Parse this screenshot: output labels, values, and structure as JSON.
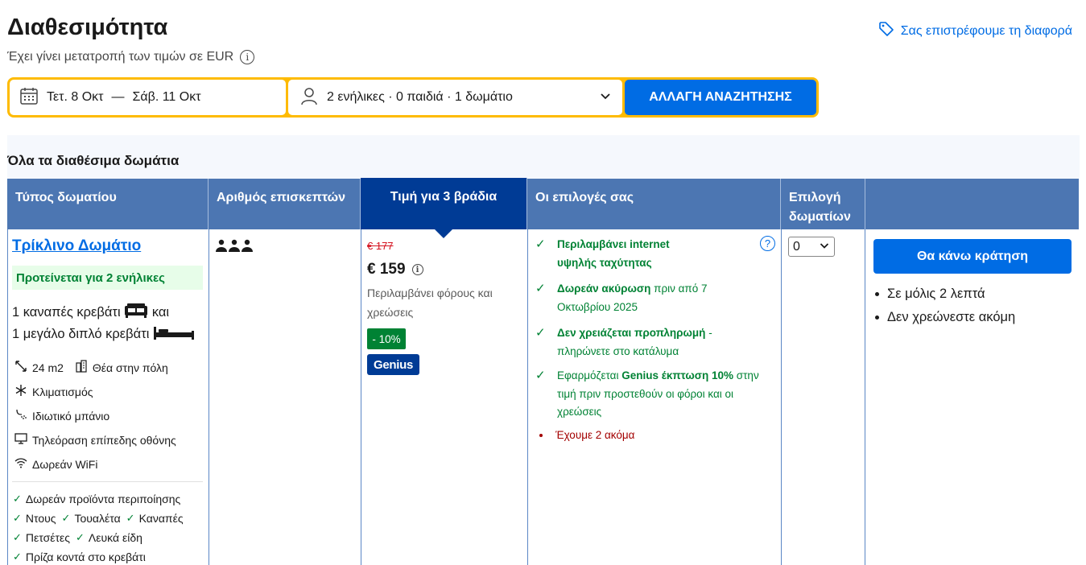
{
  "header": {
    "title": "Διαθεσιμότητα",
    "subtitle": "Έχει γίνει μετατροπή των τιμών σε EUR",
    "info_glyph": "i",
    "price_match": "Σας επιστρέφουμε τη διαφορά"
  },
  "search": {
    "checkin": "Τετ. 8 Οκτ",
    "separator": "—",
    "checkout": "Σάβ. 11 Οκτ",
    "guests": "2 ενήλικες · 0 παιδιά · 1 δωμάτιο",
    "button": "ΑΛΛΑΓΗ ΑΝΑΖΗΤΗΣΗΣ"
  },
  "section_title": "Όλα τα διαθέσιμα δωμάτια",
  "table_headers": {
    "room_type": "Τύπος δωματίου",
    "guests": "Αριθμός επισκεπτών",
    "price": "Τιμή για 3 βράδια",
    "options": "Οι επιλογές σας",
    "select_line1": "Επιλογή",
    "select_line2": "δωματίων"
  },
  "room": {
    "name": "Τρίκλινο Δωμάτιο",
    "recommended": "Προτείνεται για 2 ενήλικες",
    "bed1": "1 καναπές κρεβάτι",
    "bed_and": "και",
    "bed2": "1 μεγάλο διπλό κρεβάτι",
    "size": "24 m2",
    "view": "Θέα στην πόλη",
    "ac": "Κλιματισμός",
    "bathroom": "Ιδιωτικό μπάνιο",
    "tv": "Τηλεόραση επίπεδης οθόνης",
    "wifi": "Δωρεάν WiFi",
    "amenities": {
      "toiletries": "Δωρεάν προϊόντα περιποίησης",
      "shower": "Ντους",
      "toilet": "Τουαλέτα",
      "sofa": "Καναπές",
      "towels": "Πετσέτες",
      "linen": "Λευκά είδη",
      "socket": "Πρίζα κοντά στο κρεβάτι"
    }
  },
  "pricing": {
    "old_price": "€ 177",
    "price": "€ 159",
    "tax_note": "Περιλαμβάνει φόρους και χρεώσεις",
    "discount": "- 10%",
    "genius": "Genius"
  },
  "options": {
    "internet_bold": "Περιλαμβάνει internet υψηλής ταχύτητας",
    "cancel_bold": "Δωρεάν ακύρωση",
    "cancel_rest": "πριν από 7 Οκτωβρίου 2025",
    "prepay_bold": "Δεν χρειάζεται προπληρωμή",
    "prepay_rest": "- πληρώνετε στο κατάλυμα",
    "genius_pre": "Εφαρμόζεται",
    "genius_bold": "Genius έκπτωση 10%",
    "genius_rest": "στην τιμή πριν προστεθούν οι φόροι και οι χρεώσεις",
    "scarcity": "Έχουμε 2 ακόμα",
    "help_glyph": "?"
  },
  "select": {
    "value": "0"
  },
  "reserve": {
    "button": "Θα κάνω κράτηση",
    "bullet1": "Σε μόλις 2 λεπτά",
    "bullet2": "Δεν χρεώνεστε ακόμη"
  },
  "colors": {
    "brand_blue": "#006ce4",
    "header_blue": "#4c76b2",
    "active_header": "#003b95",
    "search_border": "#febb02",
    "green": "#008234",
    "red": "#d4111e"
  }
}
